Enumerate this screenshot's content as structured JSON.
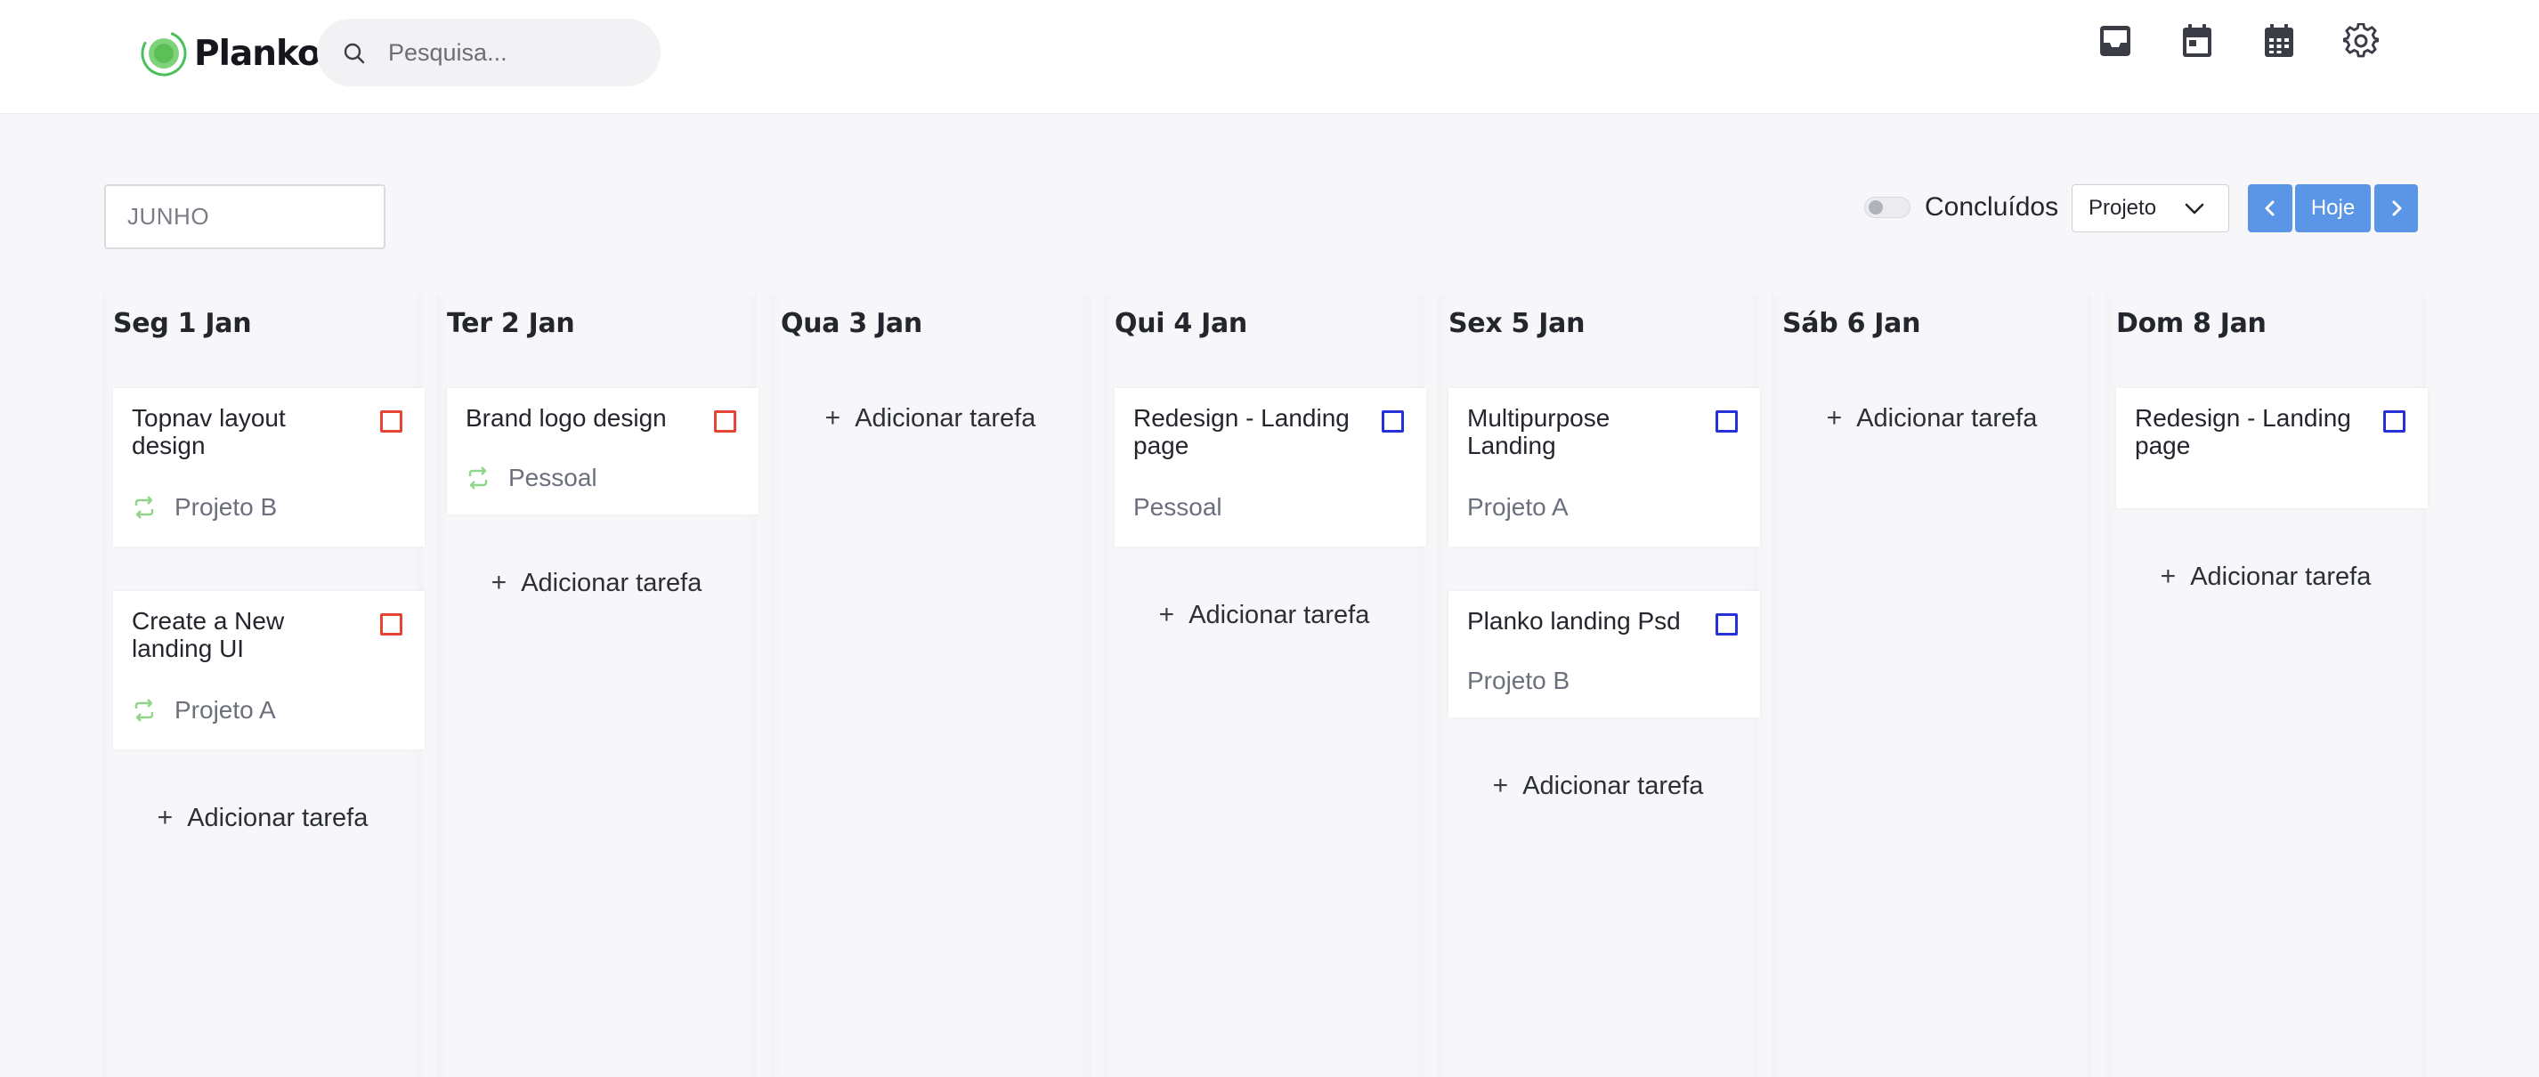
{
  "brand": {
    "name": "Planko",
    "accent": "#4cc15a"
  },
  "search": {
    "placeholder": "Pesquisa..."
  },
  "header_icons": [
    "inbox-icon",
    "calendar-day-icon",
    "calendar-grid-icon",
    "gear-icon"
  ],
  "toolbar": {
    "month_value": "JUNHO",
    "completed_label": "Concluídos",
    "completed_on": false,
    "project_select": "Projeto",
    "today_label": "Hoje",
    "nav_color": "#5b96e6"
  },
  "add_task_label": "Adicionar tarefa",
  "days": [
    {
      "label": "Seg 1 Jan",
      "cards": [
        {
          "title": "Topnav layout design",
          "project": "Projeto B",
          "repeat": true,
          "check_color": "red"
        },
        {
          "title": "Create a New landing UI",
          "project": "Projeto A",
          "repeat": true,
          "check_color": "red"
        }
      ]
    },
    {
      "label": "Ter 2 Jan",
      "cards": [
        {
          "title": "Brand logo design",
          "project": "Pessoal",
          "repeat": true,
          "check_color": "red"
        }
      ]
    },
    {
      "label": "Qua 3 Jan",
      "cards": []
    },
    {
      "label": "Qui 4 Jan",
      "cards": [
        {
          "title": "Redesign - Landing page",
          "project": "Pessoal",
          "repeat": false,
          "check_color": "blue"
        }
      ]
    },
    {
      "label": "Sex 5 Jan",
      "cards": [
        {
          "title": "Multipurpose Landing",
          "project": "Projeto A",
          "repeat": false,
          "check_color": "blue"
        },
        {
          "title": "Planko landing Psd",
          "project": "Projeto B",
          "repeat": false,
          "check_color": "blue"
        }
      ]
    },
    {
      "label": "Sáb 6 Jan",
      "cards": []
    },
    {
      "label": "Dom 8 Jan",
      "cards": [
        {
          "title": "Redesign - Landing page",
          "project": "",
          "repeat": false,
          "check_color": "blue"
        }
      ]
    }
  ]
}
